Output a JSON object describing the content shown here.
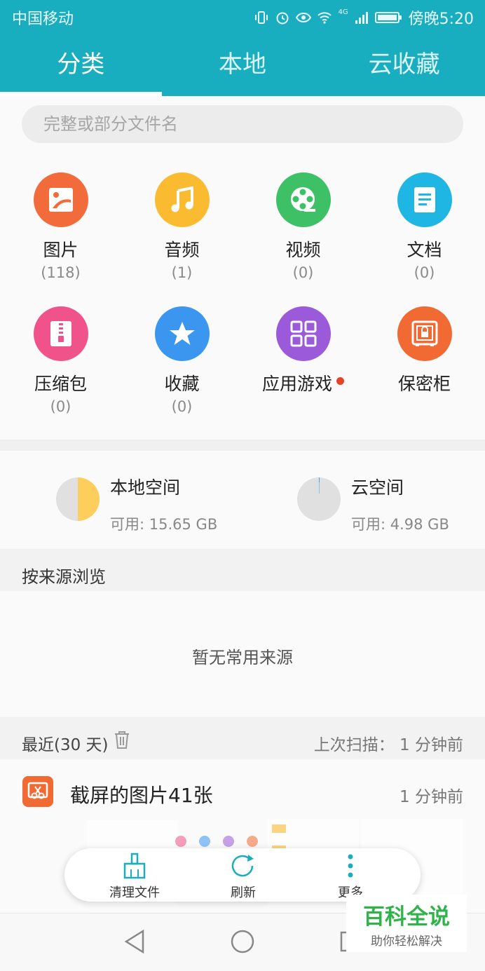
{
  "status_bar": {
    "carrier": "中国移动",
    "time": "傍晚5:20",
    "network": "4G"
  },
  "tabs": [
    {
      "label": "分类",
      "active": true
    },
    {
      "label": "本地",
      "active": false
    },
    {
      "label": "云收藏",
      "active": false
    }
  ],
  "search": {
    "placeholder": "完整或部分文件名"
  },
  "categories": [
    {
      "label": "图片",
      "count": "(118)",
      "color": "#f26b3a",
      "icon": "image-icon"
    },
    {
      "label": "音频",
      "count": "(1)",
      "color": "#fbbb31",
      "icon": "music-icon"
    },
    {
      "label": "视频",
      "count": "(0)",
      "color": "#3ec066",
      "icon": "film-reel-icon"
    },
    {
      "label": "文档",
      "count": "(0)",
      "color": "#1fb6e3",
      "icon": "document-icon"
    },
    {
      "label": "压缩包",
      "count": "(0)",
      "color": "#f0528a",
      "icon": "zip-icon"
    },
    {
      "label": "收藏",
      "count": "(0)",
      "color": "#3b96f0",
      "icon": "star-icon"
    },
    {
      "label": "应用游戏",
      "count": "",
      "color": "#9a5ad9",
      "icon": "apps-grid-icon",
      "badge": true
    },
    {
      "label": "保密柜",
      "count": "",
      "color": "#f26a33",
      "icon": "safe-icon"
    }
  ],
  "storage": {
    "local": {
      "title": "本地空间",
      "available": "可用: 15.65 GB",
      "used_fraction": 0.5
    },
    "cloud": {
      "title": "云空间",
      "available": "可用: 4.98 GB",
      "used_fraction": 0.005
    }
  },
  "browse_by_source": {
    "heading": "按来源浏览",
    "empty_text": "暂无常用来源"
  },
  "recent": {
    "heading": "最近(30 天)",
    "last_scan": "上次扫描：  1 分钟前",
    "items": [
      {
        "title": "截屏的图片41张",
        "time": "1 分钟前",
        "icon": "screenshot-scissors-icon"
      }
    ]
  },
  "bottom_actions": [
    {
      "label": "清理文件",
      "icon": "broom-icon"
    },
    {
      "label": "刷新",
      "icon": "refresh-icon"
    },
    {
      "label": "更多",
      "icon": "more-vertical-icon"
    }
  ],
  "watermark": {
    "title": "百科全说",
    "subtitle": "助你轻松解决"
  },
  "colors": {
    "header": "#19aebf",
    "accent": "#19aebf"
  }
}
